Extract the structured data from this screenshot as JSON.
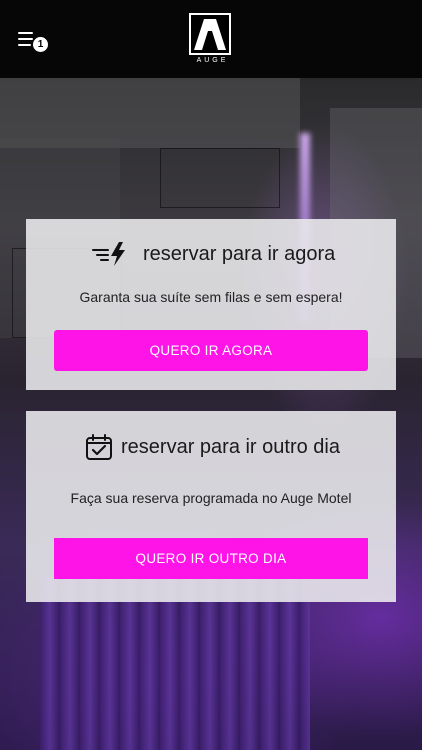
{
  "header": {
    "menu_badge": "1",
    "logo_text": "AUGE"
  },
  "cards": [
    {
      "icon": "fast-lightning-icon",
      "title": "reservar para ir agora",
      "description": "Garanta sua suíte sem filas e sem espera!",
      "button_label": "QUERO IR AGORA"
    },
    {
      "icon": "calendar-check-icon",
      "title": "reservar para ir outro dia",
      "description": "Faça sua reserva programada no Auge Motel",
      "button_label": "QUERO IR OUTRO DIA"
    }
  ],
  "colors": {
    "accent": "#ff14e8",
    "header_bg": "#060606",
    "card_bg": "#ececee"
  }
}
